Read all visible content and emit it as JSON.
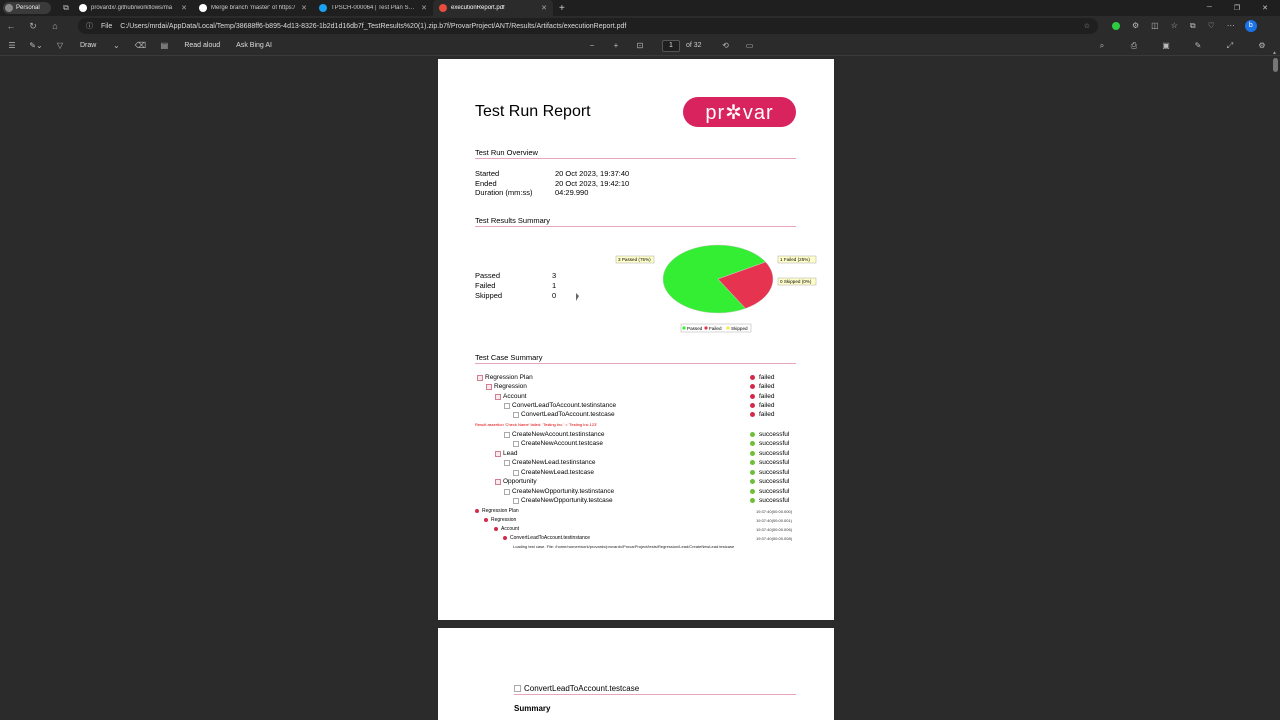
{
  "browser": {
    "profile_label": "Personal",
    "tabs": [
      {
        "label": "provardx/.github/workflows/ma",
        "favicon_color": "#ffffff",
        "active": false
      },
      {
        "label": "Merge branch 'master' of https:/",
        "favicon_color": "#ffffff",
        "active": false
      },
      {
        "label": "TPSCH-000064 | Test Plan Schedu",
        "favicon_color": "#1ca0f2",
        "active": false
      },
      {
        "label": "executionReport.pdf",
        "favicon_color": "#e74c3c",
        "active": true
      }
    ],
    "address_prefix": "File",
    "address": "C:/Users/mrdai/AppData/Local/Temp/38688ff6-b895-4d13-8326-1b2d1d16db7f_TestResults%20(1).zip.b7f/ProvarProject/ANT/Results/Artifacts/executionReport.pdf"
  },
  "pdf_toolbar": {
    "draw_label": "Draw",
    "read_aloud_label": "Read aloud",
    "ask_bing_label": "Ask Bing AI",
    "page_number": "1",
    "page_count": "of 32"
  },
  "report": {
    "title": "Test Run Report",
    "logo_text": "pr✲var",
    "overview": {
      "heading": "Test Run Overview",
      "rows": [
        {
          "label": "Started",
          "value": "20 Oct 2023, 19:37:40"
        },
        {
          "label": "Ended",
          "value": "20 Oct 2023, 19:42:10"
        },
        {
          "label": "Duration (mm:ss)",
          "value": "04:29.990"
        }
      ]
    },
    "results_summary": {
      "heading": "Test Results Summary",
      "stats": [
        {
          "label": "Passed",
          "value": "3"
        },
        {
          "label": "Failed",
          "value": "1"
        },
        {
          "label": "Skipped",
          "value": "0"
        }
      ]
    },
    "test_case_summary": {
      "heading": "Test Case Summary",
      "tree": [
        {
          "name": "Regression Plan",
          "status": "failed",
          "icon": "plan"
        },
        {
          "name": "Regression",
          "status": "failed",
          "icon": "plan"
        },
        {
          "name": "Account",
          "status": "failed",
          "icon": "plan"
        },
        {
          "name": "ConvertLeadToAccount.testinstance",
          "status": "failed",
          "icon": "file"
        },
        {
          "name": "ConvertLeadToAccount.testcase",
          "status": "failed",
          "icon": "file"
        },
        {
          "name": "CreateNewAccount.testinstance",
          "status": "successful",
          "icon": "file"
        },
        {
          "name": "CreateNewAccount.testcase",
          "status": "successful",
          "icon": "file"
        },
        {
          "name": "Lead",
          "status": "successful",
          "icon": "plan"
        },
        {
          "name": "CreateNewLead.testinstance",
          "status": "successful",
          "icon": "file"
        },
        {
          "name": "CreateNewLead.testcase",
          "status": "successful",
          "icon": "file"
        },
        {
          "name": "Opportunity",
          "status": "successful",
          "icon": "plan"
        },
        {
          "name": "CreateNewOpportunity.testinstance",
          "status": "successful",
          "icon": "file"
        },
        {
          "name": "CreateNewOpportunity.testcase",
          "status": "successful",
          "icon": "file"
        }
      ],
      "error_message": "Result assertion 'Check Name' failed: 'Testing Inc.' = 'Testing Inc.123'",
      "log": [
        {
          "name": "Regression Plan",
          "time": "19:37:40(00:00.000)"
        },
        {
          "name": "Regression",
          "time": "19:37:40(00:00.001)"
        },
        {
          "name": "Account",
          "time": "19:37:40(00:00.006)"
        },
        {
          "name": "ConvertLeadToAccount.testinstance",
          "time": "19:37:40(00:00.008)"
        }
      ],
      "loading_text": "Loading test case. File: /home/runner/work/provardx/provardx/ProvarProject/tests/Regression/Lead/CreateNewLead.testcase"
    },
    "status_colors": {
      "failed": "#d22b4a",
      "successful": "#6dbf3a"
    }
  },
  "chart_data": {
    "type": "pie",
    "categories": [
      "Passed",
      "Failed",
      "Skipped"
    ],
    "values": [
      3,
      1,
      0
    ],
    "slice_labels": [
      "3 Passed (75%)",
      "1 Failed (25%)",
      "0 Skipped (0%)"
    ],
    "legend": [
      "Passed",
      "Failed",
      "Skipped"
    ],
    "colors": [
      "#33ee33",
      "#e6334f",
      "#eeee44"
    ],
    "legend_position": "bottom"
  },
  "page2": {
    "title": "ConvertLeadToAccount.testcase",
    "summary_heading": "Summary"
  }
}
